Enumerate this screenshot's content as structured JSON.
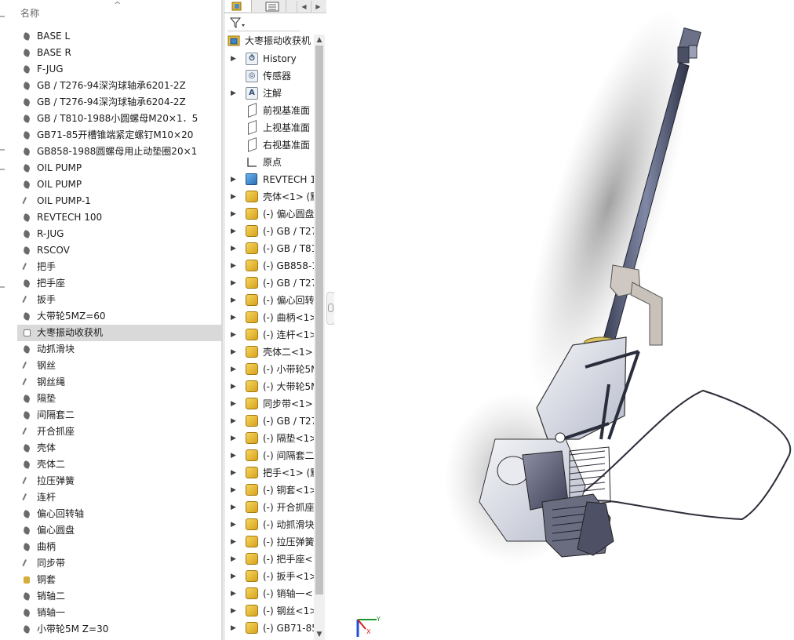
{
  "explorer": {
    "column_header": "名称",
    "sort_indicator": "^",
    "files": [
      {
        "name": "BASE L",
        "icon": "part-icon"
      },
      {
        "name": "BASE R",
        "icon": "part-icon"
      },
      {
        "name": "F-JUG",
        "icon": "part-icon"
      },
      {
        "name": "GB / T276-94深沟球轴承6201-2Z",
        "icon": "part-icon"
      },
      {
        "name": "GB / T276-94深沟球轴承6204-2Z",
        "icon": "part-icon"
      },
      {
        "name": "GB / T810-1988小圆螺母M20×1．5",
        "icon": "part-icon"
      },
      {
        "name": "GB71-85开槽锥端紧定螺钉M10×20",
        "icon": "part-icon"
      },
      {
        "name": "GB858-1988圆螺母用止动垫圈20×1",
        "icon": "part-icon"
      },
      {
        "name": "OIL PUMP",
        "icon": "part-icon"
      },
      {
        "name": "OIL PUMP",
        "icon": "part-icon"
      },
      {
        "name": "OIL PUMP-1",
        "icon": "thin-part-icon"
      },
      {
        "name": "REVTECH 100",
        "icon": "part-icon"
      },
      {
        "name": "R-JUG",
        "icon": "part-icon"
      },
      {
        "name": "RSCOV",
        "icon": "part-icon"
      },
      {
        "name": "把手",
        "icon": "thin-part-icon"
      },
      {
        "name": "把手座",
        "icon": "part-icon"
      },
      {
        "name": "扳手",
        "icon": "thin-part-icon"
      },
      {
        "name": "大带轮5MZ=60",
        "icon": "part-icon"
      },
      {
        "name": "大枣振动收获机",
        "icon": "assembly-icon",
        "selected": true
      },
      {
        "name": "动抓滑块",
        "icon": "part-icon"
      },
      {
        "name": "钢丝",
        "icon": "thin-part-icon"
      },
      {
        "name": "钢丝绳",
        "icon": "thin-part-icon"
      },
      {
        "name": "隔垫",
        "icon": "part-icon"
      },
      {
        "name": "间隔套二",
        "icon": "part-icon"
      },
      {
        "name": "开合抓座",
        "icon": "thin-part-icon"
      },
      {
        "name": "壳体",
        "icon": "part-icon"
      },
      {
        "name": "壳体二",
        "icon": "part-icon"
      },
      {
        "name": "拉压弹簧",
        "icon": "thin-part-icon"
      },
      {
        "name": "连杆",
        "icon": "thin-part-icon"
      },
      {
        "name": "偏心回转轴",
        "icon": "part-icon"
      },
      {
        "name": "偏心圆盘",
        "icon": "part-icon"
      },
      {
        "name": "曲柄",
        "icon": "part-icon"
      },
      {
        "name": "同步带",
        "icon": "thin-part-icon"
      },
      {
        "name": "铜套",
        "icon": "gold-part-icon"
      },
      {
        "name": "销轴二",
        "icon": "part-icon"
      },
      {
        "name": "销轴一",
        "icon": "part-icon"
      },
      {
        "name": "小带轮5M  Z=30",
        "icon": "part-icon"
      }
    ]
  },
  "feature_manager": {
    "root": "大枣振动收获机",
    "nodes": [
      {
        "label": "History",
        "icon": "history-icon",
        "expandable": true
      },
      {
        "label": "传感器",
        "icon": "sensor-icon",
        "expandable": false
      },
      {
        "label": "注解",
        "icon": "annotation-icon",
        "expandable": true
      },
      {
        "label": "前视基准面",
        "icon": "plane-icon",
        "expandable": false
      },
      {
        "label": "上视基准面",
        "icon": "plane-icon",
        "expandable": false
      },
      {
        "label": "右视基准面",
        "icon": "plane-icon",
        "expandable": false
      },
      {
        "label": "原点",
        "icon": "origin-icon",
        "expandable": false
      },
      {
        "label": "REVTECH 1",
        "icon": "subassembly-icon",
        "expandable": true
      },
      {
        "label": "壳体<1> (默",
        "icon": "component-icon",
        "expandable": true
      },
      {
        "label": "(-) 偏心圆盘",
        "icon": "component-icon",
        "expandable": true
      },
      {
        "label": "(-) GB / T27",
        "icon": "component-icon",
        "expandable": true
      },
      {
        "label": "(-) GB / T81",
        "icon": "component-icon",
        "expandable": true
      },
      {
        "label": "(-) GB858-1",
        "icon": "component-icon",
        "expandable": true
      },
      {
        "label": "(-) GB / T27",
        "icon": "component-icon",
        "expandable": true
      },
      {
        "label": "(-) 偏心回转",
        "icon": "component-icon",
        "expandable": true
      },
      {
        "label": "(-) 曲柄<1>",
        "icon": "component-icon",
        "expandable": true
      },
      {
        "label": "(-) 连杆<1>",
        "icon": "component-icon",
        "expandable": true
      },
      {
        "label": "壳体二<1>",
        "icon": "component-icon",
        "expandable": true
      },
      {
        "label": "(-) 小带轮5M",
        "icon": "component-icon",
        "expandable": true
      },
      {
        "label": "(-) 大带轮5M",
        "icon": "component-icon",
        "expandable": true
      },
      {
        "label": "同步带<1>",
        "icon": "component-icon",
        "expandable": true
      },
      {
        "label": "(-) GB / T27",
        "icon": "component-icon",
        "expandable": true
      },
      {
        "label": "(-) 隔垫<1>",
        "icon": "component-icon",
        "expandable": true
      },
      {
        "label": "(-) 间隔套二",
        "icon": "component-icon",
        "expandable": true
      },
      {
        "label": "把手<1> (默",
        "icon": "component-icon",
        "expandable": true
      },
      {
        "label": "(-) 铜套<1>",
        "icon": "component-icon",
        "expandable": true
      },
      {
        "label": "(-) 开合抓座",
        "icon": "component-icon",
        "expandable": true
      },
      {
        "label": "(-) 动抓滑块",
        "icon": "component-icon",
        "expandable": true
      },
      {
        "label": "(-) 拉压弹簧",
        "icon": "component-icon",
        "expandable": true
      },
      {
        "label": "(-) 把手座<1",
        "icon": "component-icon",
        "expandable": true
      },
      {
        "label": "(-) 扳手<1>",
        "icon": "component-icon",
        "expandable": true
      },
      {
        "label": "(-) 销轴一<1",
        "icon": "component-icon",
        "expandable": true
      },
      {
        "label": "(-) 钢丝<1>",
        "icon": "component-icon",
        "expandable": true
      },
      {
        "label": "(-) GB71-85",
        "icon": "component-icon",
        "expandable": true
      }
    ]
  },
  "viewport": {
    "triad_x": "X",
    "triad_y": "Y",
    "colors": {
      "x_axis": "#d22020",
      "y_axis": "#1d9a2c",
      "z_axis": "#1f4fd8"
    }
  }
}
